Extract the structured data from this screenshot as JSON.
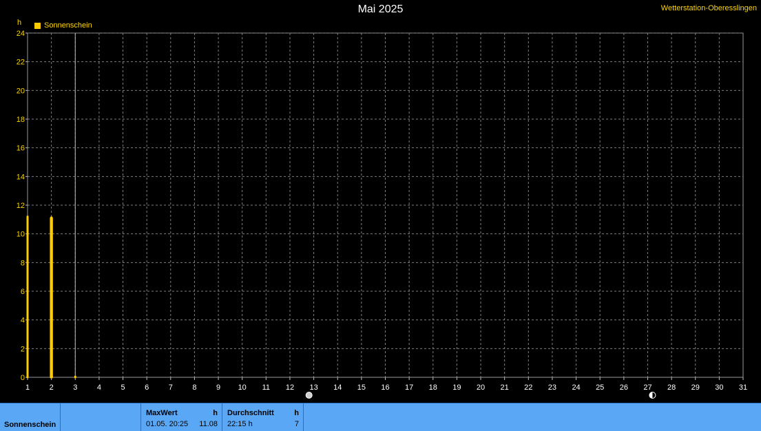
{
  "header": {
    "title": "Mai 2025",
    "station": "Wetterstation-Oberesslingen",
    "y_unit": "h"
  },
  "legend": {
    "label": "Sonnenschein",
    "color": "#ffcc00"
  },
  "chart_data": {
    "type": "bar",
    "title": "Mai 2025",
    "ylabel": "h",
    "ylim": [
      0,
      24
    ],
    "yticks": [
      0,
      2,
      4,
      6,
      8,
      10,
      12,
      14,
      16,
      18,
      20,
      22,
      24
    ],
    "xlim": [
      1,
      31
    ],
    "xticks": [
      "1",
      "2",
      "3",
      "4",
      "5",
      "6",
      "7",
      "8",
      "9",
      "10",
      "11",
      "12",
      "13",
      "14",
      "15",
      "16",
      "17",
      "18",
      "19",
      "20",
      "21",
      "22",
      "23",
      "24",
      "25",
      "26",
      "27",
      "28",
      "29",
      "30",
      "31"
    ],
    "grid": true,
    "legend_placement": "top-left",
    "series": [
      {
        "name": "Sonnenschein",
        "color": "#ffcc00",
        "points": [
          {
            "x": 1.0,
            "y": 11.2
          },
          {
            "x": 1.98,
            "y": 11.1
          },
          {
            "x": 2.0,
            "y": 11.15
          },
          {
            "x": 2.02,
            "y": 11.1
          },
          {
            "x": 3.0,
            "y": 0.05
          }
        ]
      }
    ],
    "current_marker_x": 3.0,
    "moon_phase_markers": [
      {
        "x": 12.8,
        "phase": "full-moon"
      },
      {
        "x": 27.2,
        "phase": "new-moon"
      }
    ]
  },
  "footer": {
    "row_label": "Sonnenschein",
    "max": {
      "header": "MaxWert",
      "unit": "h",
      "date": "01.05.  20:25",
      "value": "11.08"
    },
    "avg": {
      "header": "Durchschnitt",
      "unit": "h",
      "date": "22:15 h",
      "value": "7"
    }
  }
}
